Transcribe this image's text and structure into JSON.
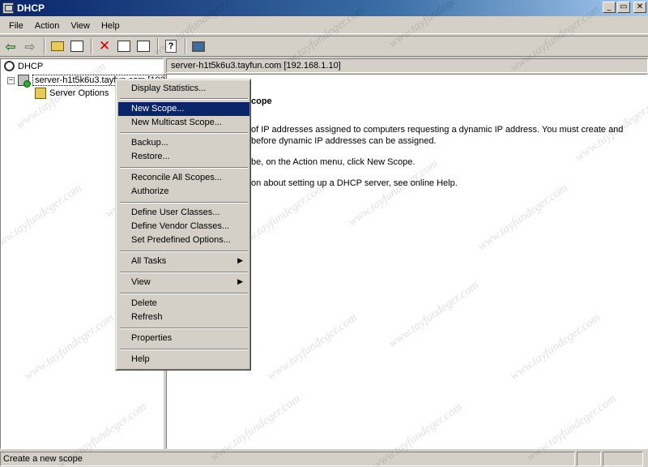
{
  "window": {
    "title": "DHCP"
  },
  "window_buttons": {
    "minimize": "_",
    "maximize": "▭",
    "close": "✕"
  },
  "menubar": {
    "items": [
      "File",
      "Action",
      "View",
      "Help"
    ]
  },
  "toolbar": {
    "icons": [
      "back-arrow-icon",
      "forward-arrow-icon",
      "up-folder-icon",
      "show-hide-tree-icon",
      "delete-icon",
      "properties-icon",
      "refresh-icon",
      "help-icon",
      "console-icon"
    ]
  },
  "tree": {
    "root": "DHCP",
    "server": "server-h1t5k6u3.tayfun.com [192.168.1.10]",
    "server_options": "Server Options",
    "expander": "−"
  },
  "content": {
    "header": "server-h1t5k6u3.tayfun.com [192.168.1.10]",
    "heading": "cope",
    "paragraphs": [
      "of IP addresses assigned to computers requesting a dynamic IP address. You must create and",
      "before dynamic IP addresses can be assigned.",
      "be, on the Action menu, click New Scope.",
      "on about setting up a DHCP server, see online Help."
    ]
  },
  "context_menu": {
    "items": [
      "Display Statistics...",
      "New Scope...",
      "New Multicast Scope...",
      "Backup...",
      "Restore...",
      "Reconcile All Scopes...",
      "Authorize",
      "Define User Classes...",
      "Define Vendor Classes...",
      "Set Predefined Options...",
      "All Tasks",
      "View",
      "Delete",
      "Refresh",
      "Properties",
      "Help"
    ],
    "highlighted": "New Scope...",
    "submenu_arrow": "▶"
  },
  "watermark": {
    "text": "www.tayfundeger.com"
  },
  "statusbar": {
    "text": "Create a new scope"
  },
  "colors": {
    "titlebar": "#0a246a",
    "highlight": "#0a246a",
    "face": "#d4d0c8"
  }
}
